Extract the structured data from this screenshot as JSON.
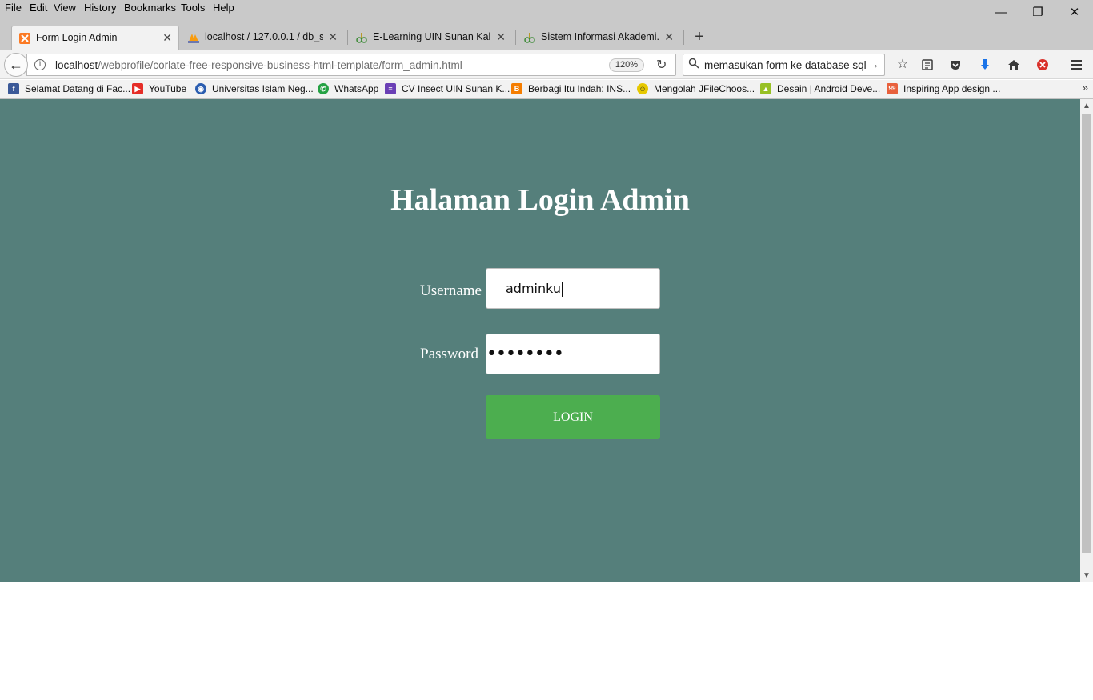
{
  "menu": [
    "File",
    "Edit",
    "View",
    "History",
    "Bookmarks",
    "Tools",
    "Help"
  ],
  "window_controls": {
    "minimize": "—",
    "restore": "❐",
    "close": "✕"
  },
  "tabs": [
    {
      "title": "Form Login Admin",
      "active": true,
      "icon": "xampp-icon"
    },
    {
      "title": "localhost / 127.0.0.1 / db_s...",
      "active": false,
      "icon": "phpmyadmin-icon"
    },
    {
      "title": "E-Learning UIN Sunan Kali...",
      "active": false,
      "icon": "uin-icon"
    },
    {
      "title": "Sistem Informasi Akademi...",
      "active": false,
      "icon": "uin-icon"
    }
  ],
  "navbar": {
    "url_host": "localhost",
    "url_path": "/webprofile/corlate-free-responsive-business-html-template/form_admin.html",
    "zoom": "120%",
    "search_text": "memasukan form ke database sql"
  },
  "bookmarks": [
    {
      "label": "Selamat Datang di Fac...",
      "icon": "facebook-icon",
      "color": "#3b5998",
      "glyph": "f"
    },
    {
      "label": "YouTube",
      "icon": "youtube-icon",
      "color": "#e52d27",
      "glyph": "▶"
    },
    {
      "label": "Universitas Islam Neg...",
      "icon": "globe-icon",
      "color": "#2a5db0",
      "glyph": "◉"
    },
    {
      "label": "WhatsApp",
      "icon": "whatsapp-icon",
      "color": "#25a244",
      "glyph": "✆"
    },
    {
      "label": "CV Insect UIN Sunan K...",
      "icon": "list-icon",
      "color": "#6a3fb5",
      "glyph": "≡"
    },
    {
      "label": "Berbagi Itu Indah: INS...",
      "icon": "blogger-icon",
      "color": "#f57d00",
      "glyph": "B"
    },
    {
      "label": "Mengolah JFileChoos...",
      "icon": "smiley-icon",
      "color": "#e6c800",
      "glyph": "☺"
    },
    {
      "label": "Desain | Android Deve...",
      "icon": "android-icon",
      "color": "#97c024",
      "glyph": "▲"
    },
    {
      "label": "Inspiring App design ...",
      "icon": "99designs-icon",
      "color": "#e8603c",
      "glyph": "99"
    }
  ],
  "login": {
    "title": "Halaman Login Admin",
    "username_label": "Username",
    "username_value": "adminku",
    "password_label": "Password",
    "password_value": "••••••••",
    "button_label": "LOGIN"
  },
  "colors": {
    "page_bg": "#557f7b",
    "button_bg": "#4cae4f"
  }
}
